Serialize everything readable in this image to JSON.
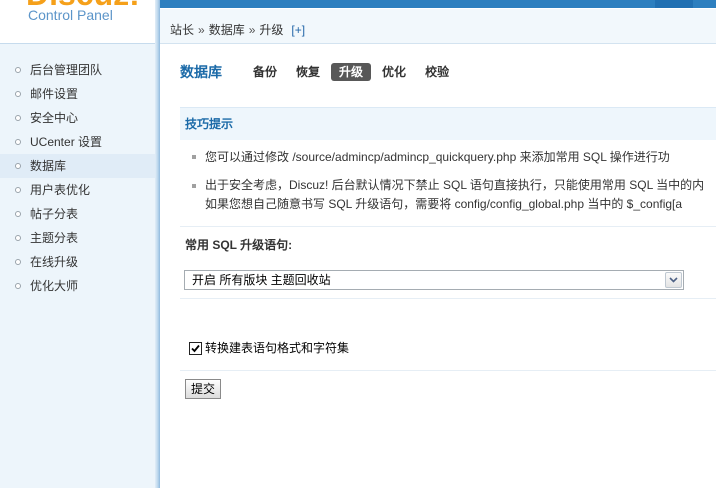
{
  "logo": {
    "brand": "Discuz!",
    "subtitle": "Control Panel"
  },
  "sidebar": {
    "items": [
      {
        "label": "后台管理团队"
      },
      {
        "label": "邮件设置"
      },
      {
        "label": "安全中心"
      },
      {
        "label": "UCenter 设置"
      },
      {
        "label": "数据库",
        "active": true
      },
      {
        "label": "用户表优化"
      },
      {
        "label": "帖子分表"
      },
      {
        "label": "主题分表"
      },
      {
        "label": "在线升级"
      },
      {
        "label": "优化大师"
      }
    ]
  },
  "breadcrumb": {
    "items": [
      "站长",
      "数据库",
      "升级"
    ],
    "separator": "»",
    "add_label": "[+]"
  },
  "page": {
    "title": "数据库",
    "tabs": [
      {
        "label": "备份"
      },
      {
        "label": "恢复"
      },
      {
        "label": "升级",
        "active": true
      },
      {
        "label": "优化"
      },
      {
        "label": "校验"
      }
    ]
  },
  "tips": {
    "title": "技巧提示",
    "items": [
      {
        "lines": [
          "您可以通过修改 /source/admincp/admincp_quickquery.php 来添加常用 SQL 操作进行功"
        ]
      },
      {
        "lines": [
          "出于安全考虑，Discuz! 后台默认情况下禁止 SQL 语句直接执行，只能使用常用 SQL 当中的内",
          "如果您想自己随意书写 SQL 升级语句，需要将 config/config_global.php 当中的 $_config[a"
        ]
      }
    ]
  },
  "form": {
    "sql_label": "常用 SQL 升级语句:",
    "sql_select": {
      "selected": "开启 所有版块 主题回收站"
    },
    "convert_checkbox": {
      "label": "转换建表语句格式和字符集",
      "checked": true
    },
    "submit_label": "提交"
  },
  "colors": {
    "top_bar": "#2d7fbf",
    "accent_blue": "#1b6aa8",
    "link_blue": "#2366a8",
    "sidebar_bg": "#edf5fb",
    "active_tab_bg": "#585858",
    "tips_header_bg": "#eef6fc",
    "logo_orange": "#f5a01a"
  },
  "icons": {
    "menu_bullet": "circle-bullet-icon",
    "tip_bullet": "dot-bullet-icon",
    "select_arrow": "chevron-down-icon",
    "checkbox_mark": "check-icon"
  }
}
